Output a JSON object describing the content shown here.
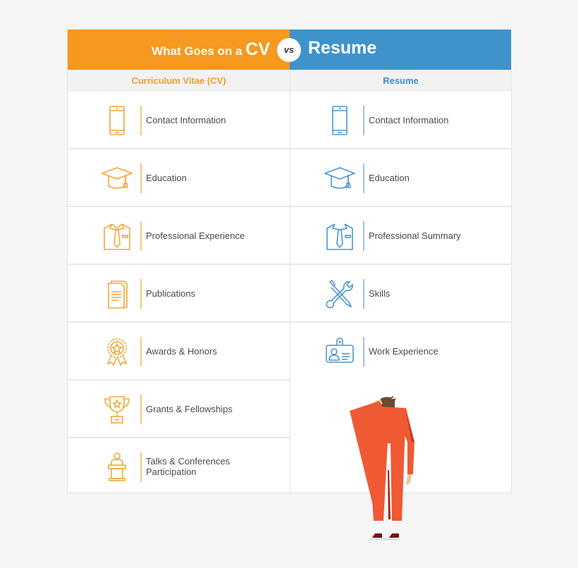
{
  "header": {
    "title_prefix": "What Goes on a",
    "title_cv": "CV",
    "vs": "vs",
    "title_resume": "Resume",
    "colors": {
      "cv": "#f7981f",
      "resume": "#3e93cd"
    }
  },
  "columns": {
    "cv": {
      "heading": "Curriculum Vitae (CV)",
      "items": [
        {
          "icon": "smartphone-icon",
          "label": "Contact Information"
        },
        {
          "icon": "graduation-cap-icon",
          "label": "Education"
        },
        {
          "icon": "shirt-tie-icon",
          "label": "Professional Experience"
        },
        {
          "icon": "documents-icon",
          "label": "Publications"
        },
        {
          "icon": "award-badge-icon",
          "label": "Awards & Honors"
        },
        {
          "icon": "trophy-icon",
          "label": "Grants & Fellowships"
        },
        {
          "icon": "speaker-podium-icon",
          "label": "Talks & Conferences Participation"
        }
      ]
    },
    "resume": {
      "heading": "Resume",
      "items": [
        {
          "icon": "smartphone-icon",
          "label": "Contact Information"
        },
        {
          "icon": "graduation-cap-icon",
          "label": "Education"
        },
        {
          "icon": "shirt-tie-icon",
          "label": "Professional Summary"
        },
        {
          "icon": "tools-icon",
          "label": "Skills"
        },
        {
          "icon": "id-badge-icon",
          "label": "Work Experience"
        }
      ]
    }
  }
}
